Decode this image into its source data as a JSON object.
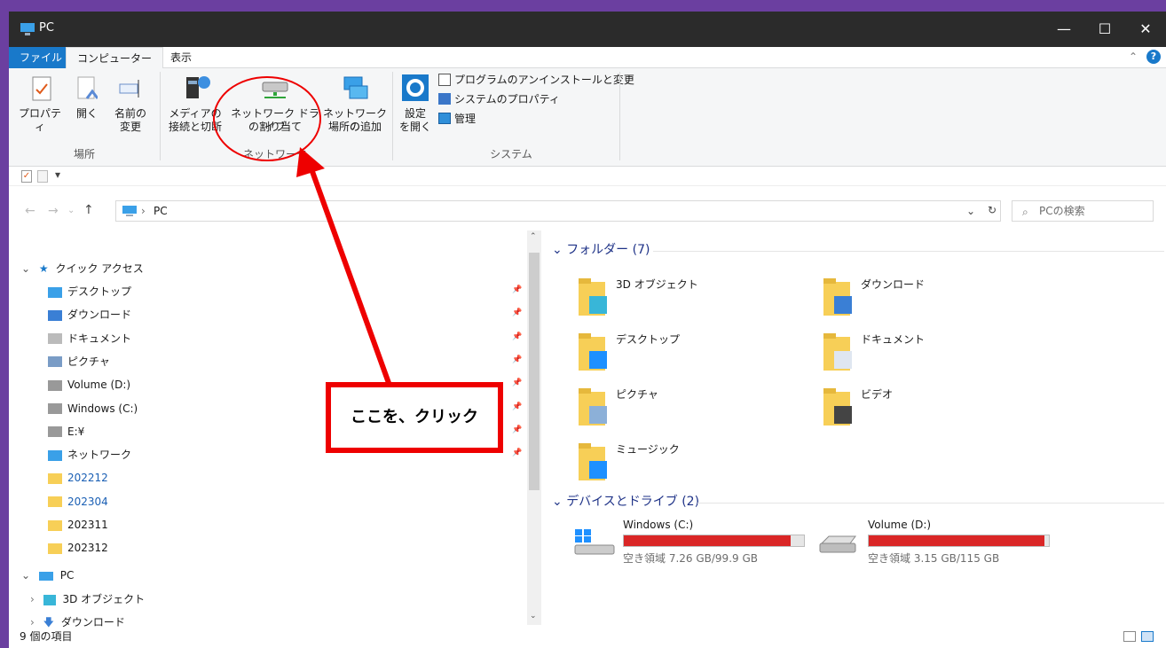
{
  "window": {
    "title": "PC",
    "minimize": "—",
    "maximize": "☐",
    "close": "✕"
  },
  "tabs": {
    "file": "ファイル",
    "computer": "コンピューター",
    "view": "表示"
  },
  "ribbon": {
    "location": {
      "properties": "プロパティ",
      "open": "開く",
      "rename_1": "名前の",
      "rename_2": "変更",
      "group": "場所"
    },
    "network": {
      "media_1": "メディアの",
      "media_2": "接続と切断",
      "map_1": "ネットワーク ドライブ",
      "map_2": "の割り当て",
      "add_1": "ネットワークの",
      "add_2": "場所の追加",
      "group": "ネットワーク"
    },
    "system": {
      "settings_1": "設定",
      "settings_2": "を開く",
      "uninstall": "プログラムのアンインストールと変更",
      "sysprops": "システムのプロパティ",
      "manage": "管理",
      "group": "システム"
    }
  },
  "address": {
    "path": "PC",
    "search_placeholder": "PCの検索"
  },
  "nav": {
    "quick_access": "クイック アクセス",
    "items": [
      {
        "label": "デスクトップ",
        "icon": "desktop-icon"
      },
      {
        "label": "ダウンロード",
        "icon": "download-icon"
      },
      {
        "label": "ドキュメント",
        "icon": "document-icon"
      },
      {
        "label": "ピクチャ",
        "icon": "pictures-icon"
      },
      {
        "label": "Volume (D:)",
        "icon": "drive-icon"
      },
      {
        "label": "Windows (C:)",
        "icon": "drive-icon"
      },
      {
        "label": "E:¥",
        "icon": "drive-icon"
      },
      {
        "label": "ネットワーク",
        "icon": "network-icon"
      },
      {
        "label": "202212",
        "icon": "folder-icon"
      },
      {
        "label": "202304",
        "icon": "folder-icon"
      },
      {
        "label": "202311",
        "icon": "folder-icon"
      },
      {
        "label": "202312",
        "icon": "folder-icon"
      }
    ],
    "pc": "PC",
    "pc_children": [
      "3D オブジェクト",
      "ダウンロード"
    ]
  },
  "content": {
    "folders_header": "フォルダー (7)",
    "folders": [
      "3D オブジェクト",
      "ダウンロード",
      "デスクトップ",
      "ドキュメント",
      "ピクチャ",
      "ビデオ",
      "ミュージック"
    ],
    "drives_header": "デバイスとドライブ (2)",
    "drives": [
      {
        "name": "Windows (C:)",
        "free": "空き領域 7.26 GB/99.9 GB",
        "used_fraction": 0.927
      },
      {
        "name": "Volume (D:)",
        "free": "空き領域 3.15 GB/115 GB",
        "used_fraction": 0.973
      }
    ]
  },
  "status": {
    "items": "9 個の項目"
  },
  "annotation": {
    "callout": "ここを、クリック"
  },
  "colors": {
    "accent": "#1979ca",
    "annotation": "#e00000",
    "bar": "#da2626"
  }
}
